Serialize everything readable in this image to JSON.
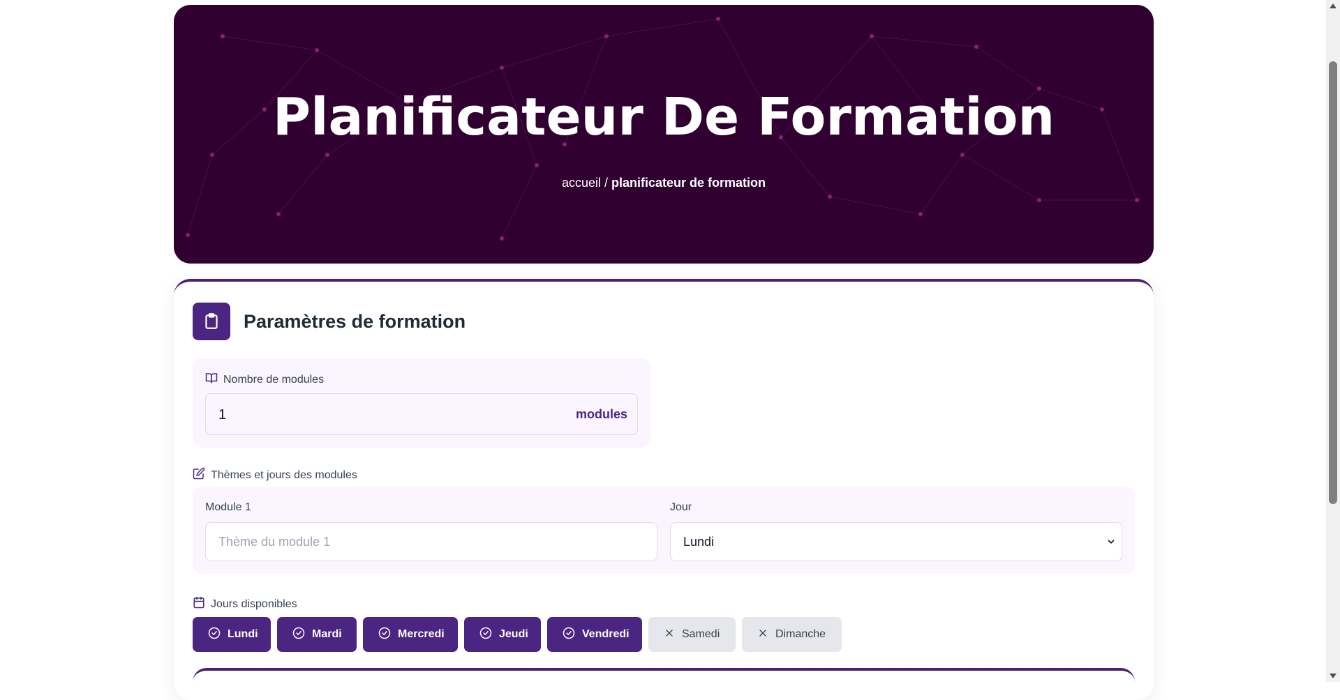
{
  "hero": {
    "title": "Planificateur De Formation",
    "breadcrumb_home": "accueil",
    "breadcrumb_sep": "/",
    "breadcrumb_current": "planificateur de formation"
  },
  "settings": {
    "title": "Paramètres de formation",
    "module_count_label": "Nombre de modules",
    "module_count_value": "1",
    "module_count_suffix": "modules",
    "themes_label": "Thèmes et jours des modules",
    "module_label": "Module 1",
    "module_theme_placeholder": "Thème du module 1",
    "day_label": "Jour",
    "day_value": "Lundi",
    "available_days_label": "Jours disponibles",
    "days": [
      {
        "label": "Lundi",
        "selected": true
      },
      {
        "label": "Mardi",
        "selected": true
      },
      {
        "label": "Mercredi",
        "selected": true
      },
      {
        "label": "Jeudi",
        "selected": true
      },
      {
        "label": "Vendredi",
        "selected": true
      },
      {
        "label": "Samedi",
        "selected": false
      },
      {
        "label": "Dimanche",
        "selected": false
      }
    ]
  },
  "colors": {
    "hero_bg": "#2f0030",
    "accent": "#4b2582",
    "panel_bg": "#faf5ff",
    "chip_off": "#e5e7eb"
  }
}
